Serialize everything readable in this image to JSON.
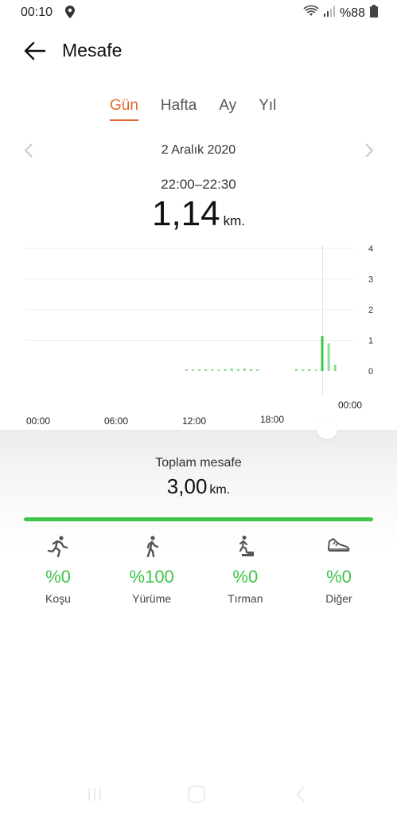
{
  "status_bar": {
    "time": "00:10",
    "battery": "%88"
  },
  "header": {
    "title": "Mesafe"
  },
  "tabs": [
    {
      "label": "Gün",
      "active": true
    },
    {
      "label": "Hafta",
      "active": false
    },
    {
      "label": "Ay",
      "active": false
    },
    {
      "label": "Yıl",
      "active": false
    }
  ],
  "date_nav": {
    "date": "2 Aralık 2020"
  },
  "selection": {
    "range": "22:00–22:30",
    "value": "1,14",
    "unit": "km."
  },
  "chart_data": {
    "type": "bar",
    "x_ticks": [
      "00:00",
      "06:00",
      "12:00",
      "18:00",
      "00:00"
    ],
    "y_ticks": [
      "4",
      "3",
      "2",
      "1",
      "0"
    ],
    "ylim": [
      0,
      4
    ],
    "grid": true,
    "selected_marker": "22:00",
    "values": [
      [
        11.5,
        0.05
      ],
      [
        12.0,
        0.04
      ],
      [
        12.5,
        0.05
      ],
      [
        13.0,
        0.05
      ],
      [
        13.5,
        0.05
      ],
      [
        14.0,
        0.04
      ],
      [
        14.5,
        0.06
      ],
      [
        15.0,
        0.08
      ],
      [
        15.5,
        0.06
      ],
      [
        16.0,
        0.08
      ],
      [
        16.5,
        0.06
      ],
      [
        17.0,
        0.05
      ],
      [
        20.0,
        0.06
      ],
      [
        20.5,
        0.04
      ],
      [
        21.0,
        0.06
      ],
      [
        21.5,
        0.04
      ],
      [
        22.0,
        1.14
      ],
      [
        22.5,
        0.9
      ],
      [
        23.0,
        0.2
      ]
    ],
    "color": "#3dc54a"
  },
  "summary": {
    "label": "Toplam mesafe",
    "value": "3,00",
    "unit": "km.",
    "progress": 1.0
  },
  "categories": [
    {
      "pct": "%0",
      "label": "Koşu",
      "icon": "running-icon"
    },
    {
      "pct": "%100",
      "label": "Yürüme",
      "icon": "walking-icon"
    },
    {
      "pct": "%0",
      "label": "Tırman",
      "icon": "climbing-icon"
    },
    {
      "pct": "%0",
      "label": "Diğer",
      "icon": "shoe-icon"
    }
  ],
  "colors": {
    "accent": "#e8662d",
    "green": "#3dc54a"
  }
}
